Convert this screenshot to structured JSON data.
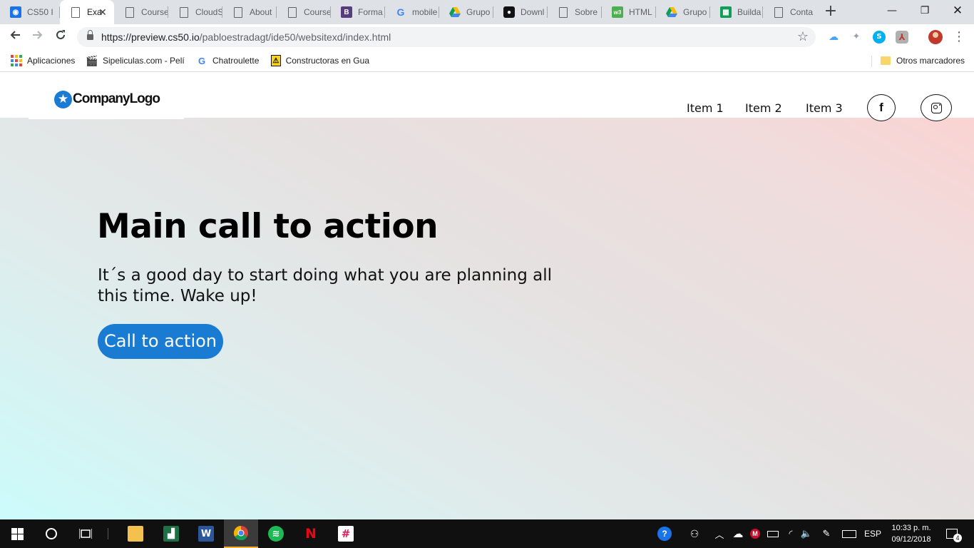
{
  "browser": {
    "tabs": [
      {
        "label": "CS50 I",
        "icon": "cs50-icon",
        "color": "#1a73e8"
      },
      {
        "label": "Exa",
        "icon": "page-icon",
        "active": true
      },
      {
        "label": "Course",
        "icon": "page-icon"
      },
      {
        "label": "CloudS",
        "icon": "page-icon"
      },
      {
        "label": "About",
        "icon": "page-icon"
      },
      {
        "label": "Course",
        "icon": "page-icon"
      },
      {
        "label": "Forma",
        "icon": "bootstrap-icon",
        "color": "#563d7c"
      },
      {
        "label": "mobile",
        "icon": "google-icon"
      },
      {
        "label": "Grupo",
        "icon": "google-drive-icon"
      },
      {
        "label": "Downl",
        "icon": "camera-icon"
      },
      {
        "label": "Sobre",
        "icon": "page-icon"
      },
      {
        "label": "HTML",
        "icon": "w3schools-icon",
        "color": "#4caf50"
      },
      {
        "label": "Grupo",
        "icon": "google-drive-icon"
      },
      {
        "label": "Builda",
        "icon": "google-sheets-icon",
        "color": "#0f9d58"
      },
      {
        "label": "Conta",
        "icon": "page-icon"
      }
    ],
    "close_glyph": "✕",
    "new_tab_glyph": "+",
    "window_controls": {
      "minimize": "—",
      "restore": "❐",
      "close": "✕"
    },
    "url_host": "https://preview.cs50.io",
    "url_path": "/pabloestradagt/ide50/websitexd/index.html",
    "bookmarks": [
      {
        "label": "Aplicaciones",
        "icon": "apps-grid-icon"
      },
      {
        "label": "Sipeliculas.com - Pelí",
        "icon": "clapperboard-icon"
      },
      {
        "label": "Chatroulette",
        "icon": "google-icon"
      },
      {
        "label": "Constructoras en Gua",
        "icon": "construction-icon"
      }
    ],
    "other_bookmarks": "Otros marcadores"
  },
  "site": {
    "logo_text": "CompanyLogo",
    "logo_star": "★",
    "nav_items": [
      "Item 1",
      "Item 2",
      "Item 3"
    ],
    "facebook_glyph": "f",
    "hero": {
      "title": "Main call to action",
      "subtitle": "It´s a good day to start doing what you are planning all this time. Wake up!",
      "cta_label": "Call to action"
    },
    "colors": {
      "accent": "#1a7bd3",
      "gradient_left": "#ccfbfb",
      "gradient_right": "#fcd1cf"
    }
  },
  "taskbar": {
    "language": "ESP",
    "time": "10:33 p. m.",
    "date": "09/12/2018",
    "notifications": "4",
    "pinned": [
      "windows-start-icon",
      "cortana-icon",
      "task-view-icon",
      "file-explorer-icon",
      "excel-icon",
      "word-icon",
      "chrome-icon",
      "spotify-icon",
      "netflix-icon",
      "slack-icon"
    ]
  }
}
